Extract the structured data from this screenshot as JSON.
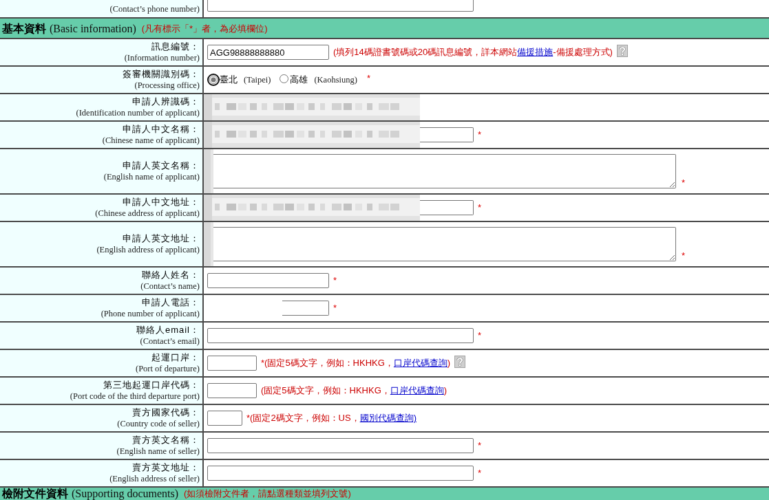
{
  "top_row": {
    "label_en": "(Contact’s phone number)",
    "field": {
      "kind": "wide"
    }
  },
  "sections": [
    {
      "title": "基本資料",
      "title_en": "(Basic information)",
      "note": "(凡有標示「*」者，為必填欄位)",
      "rows": [
        {
          "label": "訊息編號：",
          "label_en": "(Information number)",
          "field": {
            "kind": "medium",
            "value": "AGG98888888880"
          },
          "hint": [
            {
              "kind": "text",
              "text": "(填列14碼證書號碼或20碼訊息編號，詳本網站"
            },
            {
              "kind": "link",
              "text": "備援措施"
            },
            {
              "kind": "text",
              "text": "-備援處理方式)"
            }
          ],
          "help_icon": true
        },
        {
          "label": "簽審機關識別碼：",
          "label_en": "(Processing office)",
          "field": {
            "kind": "radio",
            "options": [
              {
                "label": "臺北",
                "label_en": "(Taipei)",
                "selected": true
              },
              {
                "label": "高雄",
                "label_en": "(Kaohsiung)",
                "selected": false
              }
            ]
          },
          "required_mark": "*"
        },
        {
          "label": "申請人辨識碼：",
          "label_en": "(Identification number of applicant)",
          "field": {
            "kind": "display",
            "blurred": true
          }
        },
        {
          "label": "申請人中文名稱：",
          "label_en": "(Chinese name of applicant)",
          "field": {
            "kind": "wide",
            "blurred": true
          },
          "required_mark": "*"
        },
        {
          "label": "申請人英文名稱：",
          "label_en": "(English name of applicant)",
          "field": {
            "kind": "textarea",
            "blurred": true
          },
          "required_mark": "*"
        },
        {
          "label": "申請人中文地址：",
          "label_en": "(Chinese address of applicant)",
          "field": {
            "kind": "wide",
            "blurred": true
          },
          "required_mark": "*"
        },
        {
          "label": "申請人英文地址：",
          "label_en": "(English address of applicant)",
          "field": {
            "kind": "textarea",
            "blurred": true
          },
          "required_mark": "*"
        },
        {
          "label": "聯絡人姓名：",
          "label_en": "(Contact’s name)",
          "field": {
            "kind": "medium"
          },
          "required_mark": "*"
        },
        {
          "label": "申請人電話：",
          "label_en": "(Phone number of applicant)",
          "field": {
            "kind": "medium",
            "masked": true
          },
          "required_mark": "*"
        },
        {
          "label": "聯絡人email：",
          "label_en": "(Contact’s email)",
          "field": {
            "kind": "wide"
          },
          "required_mark": "*"
        },
        {
          "label": "起運口岸：",
          "label_en": "(Port of departure)",
          "field": {
            "kind": "short"
          },
          "required_mark": "*",
          "hint": [
            {
              "kind": "text",
              "text": "(固定5碼文字，例如：HKHKG，"
            },
            {
              "kind": "link",
              "text": "口岸代碼查詢"
            },
            {
              "kind": "text",
              "text": ")"
            }
          ],
          "help_icon": true
        },
        {
          "label": "第三地起運口岸代碼：",
          "label_en": "(Port code of the third departure port)",
          "field": {
            "kind": "short"
          },
          "hint": [
            {
              "kind": "text",
              "text": "(固定5碼文字，例如：HKHKG，"
            },
            {
              "kind": "link",
              "text": "口岸代碼查詢"
            },
            {
              "kind": "text",
              "text": ")"
            }
          ]
        },
        {
          "label": "賣方國家代碼：",
          "label_en": "(Country code of seller)",
          "field": {
            "kind": "tiny"
          },
          "required_mark": "*",
          "hint": [
            {
              "kind": "text",
              "text": "(固定2碼文字，例如：US，"
            },
            {
              "kind": "link",
              "text": "國別代碼查詢)"
            }
          ]
        },
        {
          "label": "賣方英文名稱：",
          "label_en": "(English name of seller)",
          "field": {
            "kind": "wide"
          },
          "required_mark": "*"
        },
        {
          "label": "賣方英文地址：",
          "label_en": "(English address of seller)",
          "field": {
            "kind": "wide"
          },
          "required_mark": "*"
        }
      ]
    },
    {
      "title": "檢附文件資料",
      "title_en": "(Supporting documents)",
      "note": "(如須檢附文件者，請點選種類並填列文號)"
    }
  ]
}
